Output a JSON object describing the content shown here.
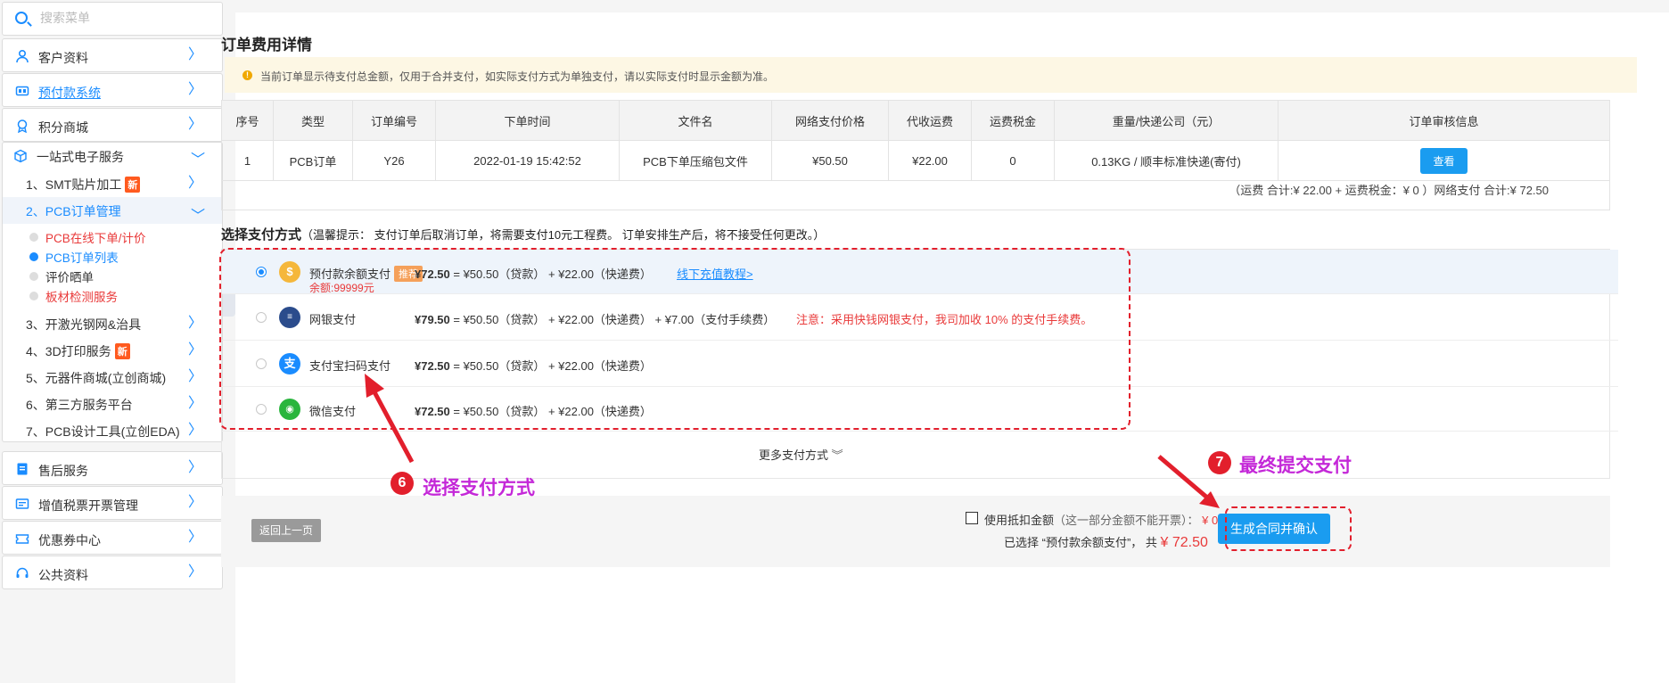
{
  "sidebar": {
    "search_placeholder": "搜索菜单",
    "top_items": [
      {
        "label": "客户资料"
      },
      {
        "label": "预付款系统"
      },
      {
        "label": "积分商城"
      }
    ],
    "open_group": {
      "label": "一站式电子服务",
      "subs": [
        {
          "label": "1、SMT贴片加工",
          "badge": "新"
        },
        {
          "label": "2、PCB订单管理"
        },
        {
          "label": "3、开激光钢网&治具"
        },
        {
          "label": "4、3D打印服务",
          "badge": "新"
        },
        {
          "label": "5、元器件商城(立创商城)"
        },
        {
          "label": "6、第三方服务平台"
        },
        {
          "label": "7、PCB设计工具(立创EDA)"
        }
      ],
      "leaves": [
        {
          "label": "PCB在线下单/计价"
        },
        {
          "label": "PCB订单列表"
        },
        {
          "label": "评价晒单"
        },
        {
          "label": "板材检测服务"
        }
      ]
    },
    "bottom_items": [
      {
        "label": "售后服务"
      },
      {
        "label": "增值税票开票管理"
      },
      {
        "label": "优惠券中心"
      },
      {
        "label": "公共资料"
      }
    ]
  },
  "order": {
    "section_title": "订单费用详情",
    "notice": "当前订单显示待支付总金额，仅用于合并支付，如实际支付方式为单独支付，请以实际支付时显示金额为准。",
    "columns": [
      "序号",
      "类型",
      "订单编号",
      "下单时间",
      "文件名",
      "网络支付价格",
      "代收运费",
      "运费税金",
      "重量/快递公司（元）",
      "订单审核信息"
    ],
    "rows": [
      {
        "no": "1",
        "type": "PCB订单",
        "id": "Y26",
        "time": "2022-01-19 15:42:52",
        "file": "PCB下单压缩包文件",
        "price": "¥50.50",
        "freight": "¥22.00",
        "tax": "0",
        "weight": "0.13KG / 顺丰标准快递(寄付)",
        "action": "查看"
      }
    ],
    "summary": "（运费 合计:¥ 22.00 + 运费税金：¥ 0 ）网络支付 合计:¥ 72.50"
  },
  "payment": {
    "title": "选择支付方式",
    "tip": "（温馨提示： 支付订单后取消订单，将需要支付10元工程费。 订单安排生产后，将不接受任何更改。）",
    "methods": [
      {
        "name": "预付款余额支付",
        "tag": "推荐",
        "balance": "余额:99999元",
        "total": "¥72.50",
        "formula": " = ¥50.50（贷款） + ¥22.00（快递费）",
        "link": "线下充值教程>",
        "selected": true
      },
      {
        "name": "网银支付",
        "total": "¥79.50",
        "formula": " = ¥50.50（贷款） + ¥22.00（快递费） + ¥7.00（支付手续费）",
        "note": "注意：采用快钱网银支付，我司加收 10% 的支付手续费。"
      },
      {
        "name": "支付宝扫码支付",
        "total": "¥72.50",
        "formula": " = ¥50.50（贷款） + ¥22.00（快递费）"
      },
      {
        "name": "微信支付",
        "total": "¥72.50",
        "formula": " = ¥50.50（贷款） + ¥22.00（快递费）"
      }
    ],
    "more": "更多支付方式"
  },
  "footer": {
    "back": "返回上一页",
    "deduct_label": "使用抵扣金额",
    "deduct_hint": "（这一部分金额不能开票）：",
    "deduct_value": "¥ 0",
    "selected_prefix": "已选择 “预付款余额支付”， 共",
    "selected_total": "¥ 72.50",
    "confirm": "生成合同并确认"
  },
  "annotations": {
    "step6_num": "6",
    "step6_text": "选择支付方式",
    "step7_num": "7",
    "step7_text": "最终提交支付",
    "color": "#e21f2c"
  }
}
